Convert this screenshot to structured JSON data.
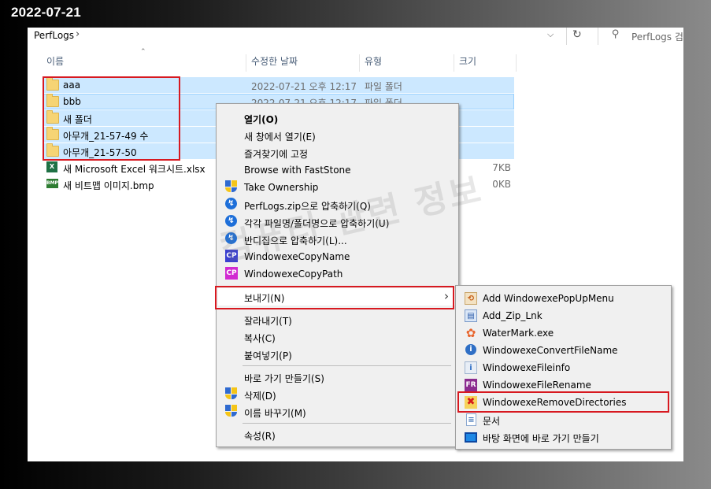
{
  "date_stamp": "2022-07-21",
  "address": {
    "crumb": "PerfLogs",
    "search_placeholder": "PerfLogs 검색"
  },
  "columns": {
    "name": "이름",
    "modified": "수정한 날짜",
    "type": "유형",
    "size": "크기"
  },
  "files": [
    {
      "name": "aaa",
      "date": "2022-07-21 오후 12:17",
      "type": "파일 폴더",
      "size": "",
      "icon": "folder-icon"
    },
    {
      "name": "bbb",
      "date": "2022-07-21 오후 12:17",
      "type": "파일 폴더",
      "size": "",
      "icon": "folder-icon"
    },
    {
      "name": "새 폴더",
      "date": "",
      "type": "",
      "size": "",
      "icon": "folder-icon"
    },
    {
      "name": "아무개_21-57-49 수",
      "date": "",
      "type": "",
      "size": "",
      "icon": "folder-icon"
    },
    {
      "name": "아무개_21-57-50",
      "date": "",
      "type": "",
      "size": "",
      "icon": "folder-icon"
    },
    {
      "name": "새 Microsoft Excel 워크시트.xlsx",
      "date": "",
      "type": "",
      "size": "7KB",
      "icon": "excel-file-icon"
    },
    {
      "name": "새 비트맵 이미지.bmp",
      "date": "",
      "type": "",
      "size": "0KB",
      "icon": "bitmap-file-icon"
    }
  ],
  "watermark": "컴퓨터 관련 정보",
  "context_menu": {
    "open": "열기(O)",
    "open_new_window": "새 창에서 열기(E)",
    "pin_quick_access": "즐겨찾기에 고정",
    "browse_faststone": "Browse with FastStone",
    "take_ownership": "Take Ownership",
    "zip_compress": "PerfLogs.zip으로 압축하기(Q)",
    "compress_each": "각각 파일명/폴더명으로 압축하기(U)",
    "bandizip": "반디집으로 압축하기(L)...",
    "copy_name": "WindowexeCopyName",
    "copy_path": "WindowexeCopyPath",
    "send_to": "보내기(N)",
    "cut": "잘라내기(T)",
    "copy": "복사(C)",
    "paste": "붙여넣기(P)",
    "create_shortcut": "바로 가기 만들기(S)",
    "delete": "삭제(D)",
    "rename": "이름 바꾸기(M)",
    "properties": "속성(R)"
  },
  "send_to_menu": [
    {
      "label": "Add WindowexePopUpMenu",
      "icon": "popup-menu-icon"
    },
    {
      "label": "Add_Zip_Lnk",
      "icon": "zip-link-icon"
    },
    {
      "label": "WaterMark.exe",
      "icon": "watermark-flower-icon"
    },
    {
      "label": "WindowexeConvertFileName",
      "icon": "convert-globe-icon"
    },
    {
      "label": "WindowexeFileinfo",
      "icon": "fileinfo-icon"
    },
    {
      "label": "WindowexeFileRename",
      "icon": "fr-icon"
    },
    {
      "label": "WindowexeRemoveDirectories",
      "icon": "remove-x-icon"
    },
    {
      "label": "문서",
      "icon": "documents-icon"
    },
    {
      "label": "바탕 화면에 바로 가기 만들기",
      "icon": "desktop-icon"
    }
  ],
  "colors": {
    "selection": "#cce8ff",
    "highlight_box": "#d71920",
    "menu_bg": "#f0f0f0"
  }
}
